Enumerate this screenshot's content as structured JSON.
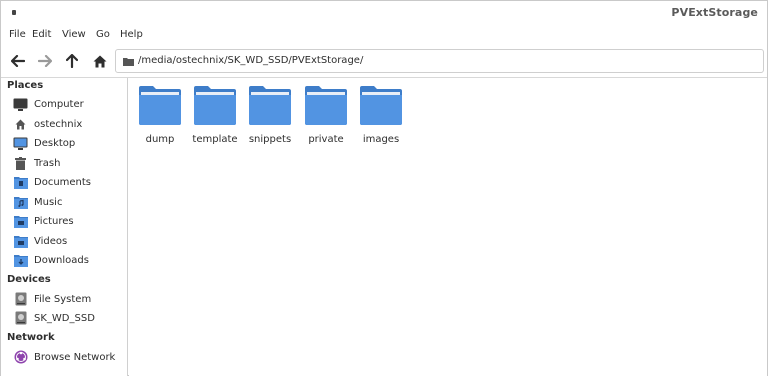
{
  "window": {
    "title": "PVExtStorage"
  },
  "menubar": {
    "items": [
      "File",
      "Edit",
      "View",
      "Go",
      "Help"
    ]
  },
  "toolbar": {
    "path": "/media/ostechnix/SK_WD_SSD/PVExtStorage/"
  },
  "sidebar": {
    "places_heading": "Places",
    "places": [
      {
        "label": "Computer",
        "icon": "computer-icon"
      },
      {
        "label": "ostechnix",
        "icon": "home-icon"
      },
      {
        "label": "Desktop",
        "icon": "desktop-icon"
      },
      {
        "label": "Trash",
        "icon": "trash-icon"
      },
      {
        "label": "Documents",
        "icon": "documents-folder-icon"
      },
      {
        "label": "Music",
        "icon": "music-folder-icon"
      },
      {
        "label": "Pictures",
        "icon": "pictures-folder-icon"
      },
      {
        "label": "Videos",
        "icon": "videos-folder-icon"
      },
      {
        "label": "Downloads",
        "icon": "downloads-folder-icon"
      }
    ],
    "devices_heading": "Devices",
    "devices": [
      {
        "label": "File System",
        "icon": "drive-icon"
      },
      {
        "label": "SK_WD_SSD",
        "icon": "drive-icon"
      }
    ],
    "network_heading": "Network",
    "network": [
      {
        "label": "Browse Network",
        "icon": "network-icon"
      }
    ]
  },
  "main": {
    "folders": [
      "dump",
      "template",
      "snippets",
      "private",
      "images"
    ]
  },
  "colors": {
    "folder_blue": "#5294e2",
    "folder_tab": "#3e7dc9"
  }
}
